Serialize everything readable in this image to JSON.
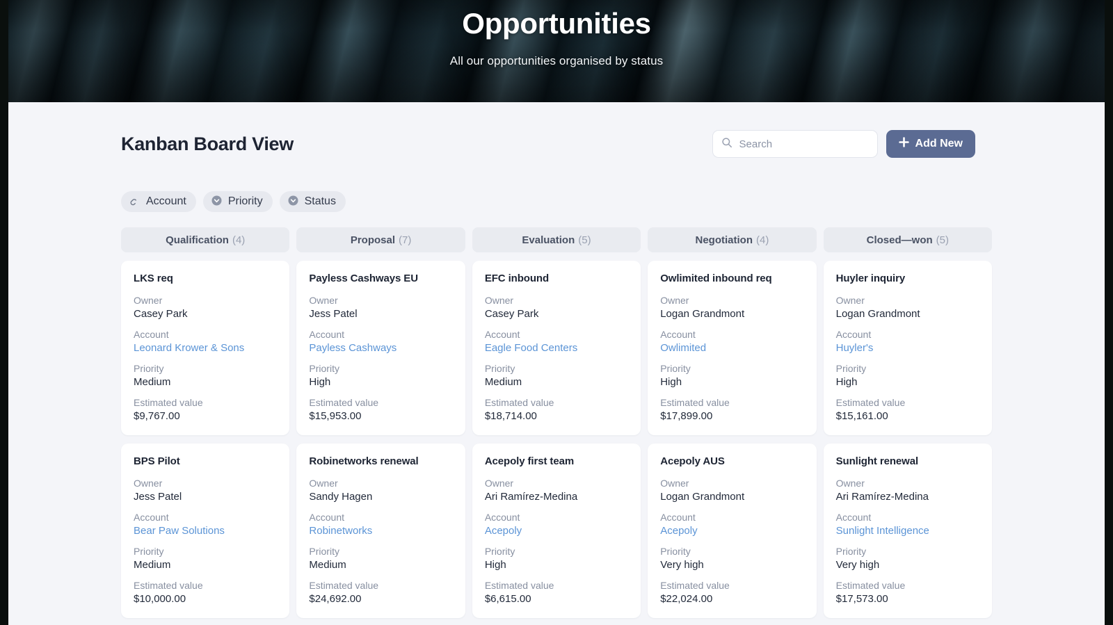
{
  "hero": {
    "title": "Opportunities",
    "subtitle": "All our opportunities organised by status"
  },
  "toolbar": {
    "page_title": "Kanban Board View",
    "search_placeholder": "Search",
    "search_value": "",
    "search_icon": "search-icon",
    "add_new_label": "Add New",
    "add_new_icon": "plus-icon",
    "add_new_color": "#5b6b93"
  },
  "filters": [
    {
      "label": "Account",
      "icon": "link-icon"
    },
    {
      "label": "Priority",
      "icon": "chevron-down-circle-icon"
    },
    {
      "label": "Status",
      "icon": "chevron-down-circle-icon"
    }
  ],
  "board": {
    "field_labels": {
      "owner": "Owner",
      "account": "Account",
      "priority": "Priority",
      "estimated_value": "Estimated value"
    },
    "columns": [
      {
        "name": "Qualification",
        "count": "(4)",
        "cards": [
          {
            "title": "LKS req",
            "owner": "Casey Park",
            "account": "Leonard Krower & Sons",
            "priority": "Medium",
            "estimated_value": "$9,767.00"
          },
          {
            "title": "BPS Pilot",
            "owner": "Jess Patel",
            "account": "Bear Paw Solutions",
            "priority": "Medium",
            "estimated_value": "$10,000.00"
          }
        ]
      },
      {
        "name": "Proposal",
        "count": "(7)",
        "cards": [
          {
            "title": "Payless Cashways EU",
            "owner": "Jess Patel",
            "account": "Payless Cashways",
            "priority": "High",
            "estimated_value": "$15,953.00"
          },
          {
            "title": "Robinetworks renewal",
            "owner": "Sandy Hagen",
            "account": "Robinetworks",
            "priority": "Medium",
            "estimated_value": "$24,692.00"
          }
        ]
      },
      {
        "name": "Evaluation",
        "count": "(5)",
        "cards": [
          {
            "title": "EFC inbound",
            "owner": "Casey Park",
            "account": "Eagle Food Centers",
            "priority": "Medium",
            "estimated_value": "$18,714.00"
          },
          {
            "title": "Acepoly first team",
            "owner": "Ari Ramírez-Medina",
            "account": "Acepoly",
            "priority": "High",
            "estimated_value": "$6,615.00"
          }
        ]
      },
      {
        "name": "Negotiation",
        "count": "(4)",
        "cards": [
          {
            "title": "Owlimited inbound req",
            "owner": "Logan Grandmont",
            "account": "Owlimited",
            "priority": "High",
            "estimated_value": "$17,899.00"
          },
          {
            "title": "Acepoly AUS",
            "owner": "Logan Grandmont",
            "account": "Acepoly",
            "priority": "Very high",
            "estimated_value": "$22,024.00"
          }
        ]
      },
      {
        "name": "Closed—won",
        "count": "(5)",
        "cards": [
          {
            "title": "Huyler inquiry",
            "owner": "Logan Grandmont",
            "account": "Huyler's",
            "priority": "High",
            "estimated_value": "$15,161.00"
          },
          {
            "title": "Sunlight renewal",
            "owner": "Ari Ramírez-Medina",
            "account": "Sunlight Intelligence",
            "priority": "Very high",
            "estimated_value": "$17,573.00"
          }
        ]
      }
    ]
  }
}
